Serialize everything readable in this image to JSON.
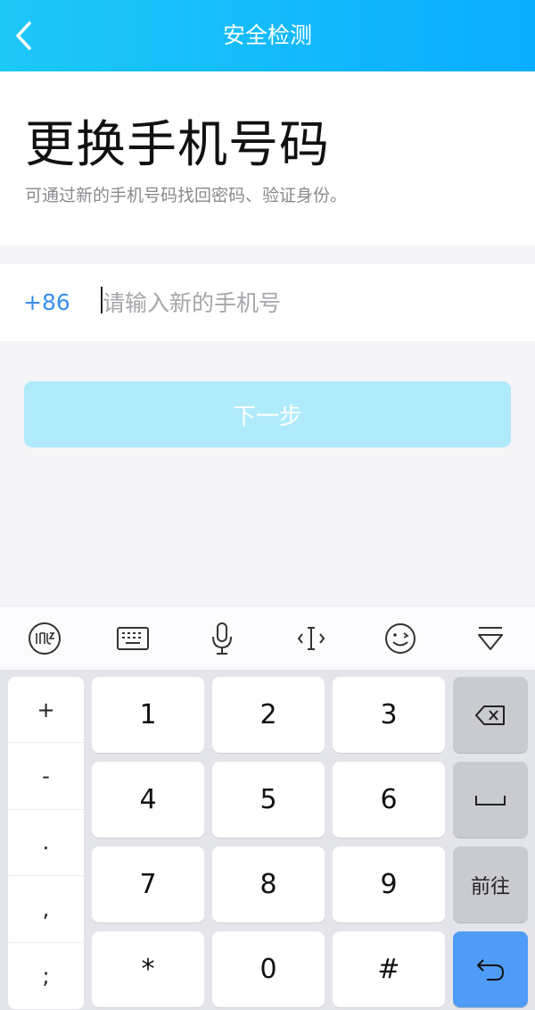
{
  "header": {
    "title": "安全检测",
    "back_icon": "chevron-left-icon"
  },
  "hero": {
    "title": "更换手机号码",
    "subtitle": "可通过新的手机号码找回密码、验证身份。"
  },
  "phone": {
    "country_code": "+86",
    "placeholder": "请输入新的手机号",
    "value": ""
  },
  "next_button": {
    "label": "下一步",
    "color": "#b0ebfc"
  },
  "keyboard": {
    "toolbar_icons": [
      "handwriting-icon",
      "keyboard-icon",
      "microphone-icon",
      "cursor-icon",
      "emoji-icon",
      "collapse-keyboard-icon"
    ],
    "symbols": [
      "+",
      "-",
      ".",
      ",",
      ";"
    ],
    "digits": [
      "1",
      "2",
      "3",
      "4",
      "5",
      "6",
      "7",
      "8",
      "9",
      "*",
      "0",
      "#"
    ],
    "go_label": "前往",
    "enter_color": "#4e9cf6"
  },
  "colors": {
    "header_start": "#1ec8f7",
    "header_end": "#0aaeff",
    "accent": "#3a8ef0"
  }
}
